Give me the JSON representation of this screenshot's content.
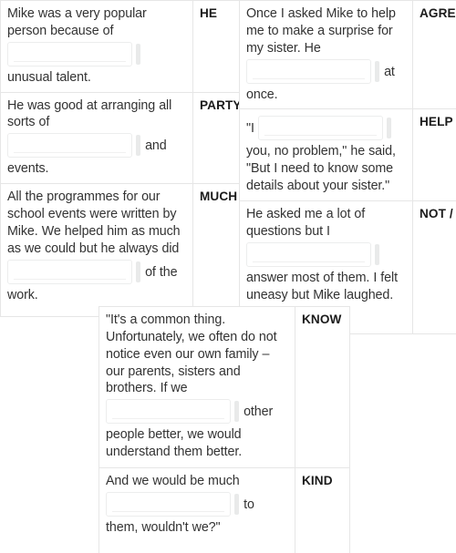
{
  "exercise": {
    "type": "gap-fill-word-formation",
    "input_placeholder": "",
    "input_value": "",
    "tables": [
      {
        "id": "table-left",
        "rows": [
          {
            "id": "row-he",
            "text_before": "Mike was a very popular person because of",
            "text_middle": "",
            "text_after": "unusual talent.",
            "prompt": "HE"
          },
          {
            "id": "row-party",
            "text_before": "He was good at arranging all sorts of",
            "text_middle": "and",
            "text_after": "events.",
            "prompt": "PARTY"
          },
          {
            "id": "row-much",
            "text_before": "All the programmes for our school events were written by Mike. We helped him as much as we could but he always did",
            "text_middle": "of the",
            "text_after": "work.",
            "prompt": "MUCH"
          }
        ]
      },
      {
        "id": "table-middle",
        "rows": [
          {
            "id": "row-agree",
            "text_before": "Once I asked Mike to help me to make a surprise for my sister. He",
            "text_middle": "at",
            "text_after": "once.",
            "prompt": "AGREE"
          },
          {
            "id": "row-help",
            "text_before": "\"I",
            "text_middle": "you,",
            "text_after": "no problem,\" he said, \"But I need to know some details about your sister.\"",
            "prompt": "HELP"
          },
          {
            "id": "row-not-can",
            "text_before": "He asked me a lot of questions but I",
            "text_middle": "",
            "text_after": "answer most of them. I felt uneasy but Mike laughed.",
            "prompt": "NOT / CAN"
          }
        ]
      },
      {
        "id": "table-bottom",
        "rows": [
          {
            "id": "row-know",
            "text_before": "\"It's a common thing. Unfortunately, we often do not notice even our own family – our parents, sisters and brothers. If we",
            "text_middle": "other",
            "text_after": "people better, we would understand them better.",
            "prompt": "KNOW"
          },
          {
            "id": "row-kind",
            "text_before": "And we would be much",
            "text_middle": "to",
            "text_after": "them, wouldn't we?\"",
            "prompt": "KIND"
          }
        ]
      }
    ]
  },
  "colors": {
    "text": "#333333",
    "prompt": "#1b1b1b",
    "border": "#e6e6e6",
    "input_border": "#eceded",
    "handle": "#e9eaea",
    "background": "#ffffff"
  }
}
